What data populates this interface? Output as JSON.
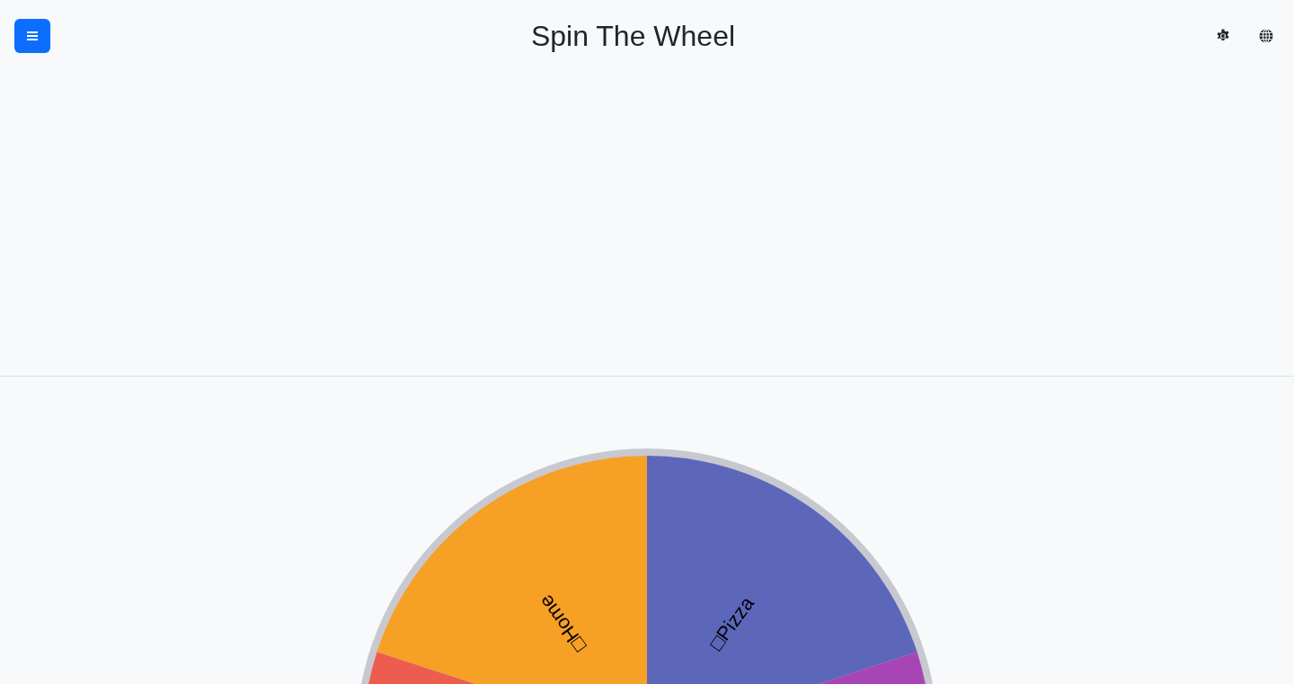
{
  "header": {
    "title": "Spin The Wheel"
  },
  "wheel": {
    "slices": [
      {
        "color": "#ec5d50"
      },
      {
        "label": "□Home",
        "color": "#f6a026"
      },
      {
        "label": "□Pizza",
        "color": "#5c67ba"
      },
      {
        "color": "#a845b6"
      }
    ]
  }
}
